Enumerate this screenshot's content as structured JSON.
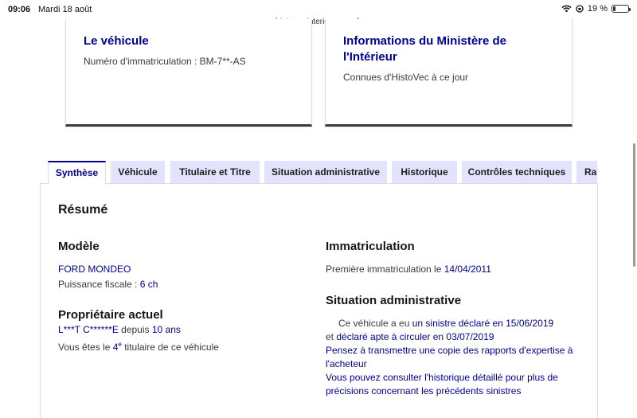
{
  "status_bar": {
    "time": "09:06",
    "date": "Mardi 18 août",
    "battery_text": "19 %",
    "battery_level": 0.19
  },
  "browser": {
    "url": "histovec.interieur.gouv.fr"
  },
  "cards": {
    "vehicle": {
      "title": "Le véhicule",
      "subtitle": "Numéro d'immatriculation : BM-7**-AS"
    },
    "ministry": {
      "title": "Informations du Ministère de l'Intérieur",
      "subtitle": "Connues d'HistoVec à ce jour"
    }
  },
  "tabs": [
    {
      "label": "Synthèse",
      "active": true
    },
    {
      "label": "Véhicule"
    },
    {
      "label": "Titulaire et Titre"
    },
    {
      "label": "Situation administrative"
    },
    {
      "label": "Historique"
    },
    {
      "label": "Contrôles techniques"
    },
    {
      "label": "Ra"
    }
  ],
  "summary": {
    "title": "Résumé",
    "model": {
      "heading": "Modèle",
      "name": "FORD MONDEO",
      "fiscal_label": "Puissance fiscale : ",
      "fiscal_value": "6 ch"
    },
    "owner": {
      "heading": "Propriétaire actuel",
      "name": "L***T C******E",
      "since_label": " depuis ",
      "since_value": "10 ans",
      "rank_prefix": "Vous êtes le ",
      "rank_num": "4",
      "rank_sup": "e",
      "rank_suffix": " titulaire de ce véhicule"
    },
    "registration": {
      "heading": "Immatriculation",
      "first_label": "Première immatriculation le ",
      "first_date": "14/04/2011"
    },
    "admin": {
      "heading": "Situation administrative",
      "line1_prefix": "Ce véhicule a eu ",
      "line1_link": "un sinistre déclaré en 15/06/2019",
      "line2_prefix": "et ",
      "line2_link": "déclaré apte à circuler en 03/07/2019",
      "advice1_a": "Pensez à transmettre une copie des rapports d'expertise à",
      "advice1_b": "l'acheteur",
      "advice2_a": "Vous pouvez consulter l'historique détaillé pour plus de",
      "advice2_b": "précisions concernant les précédents sinistres"
    }
  }
}
